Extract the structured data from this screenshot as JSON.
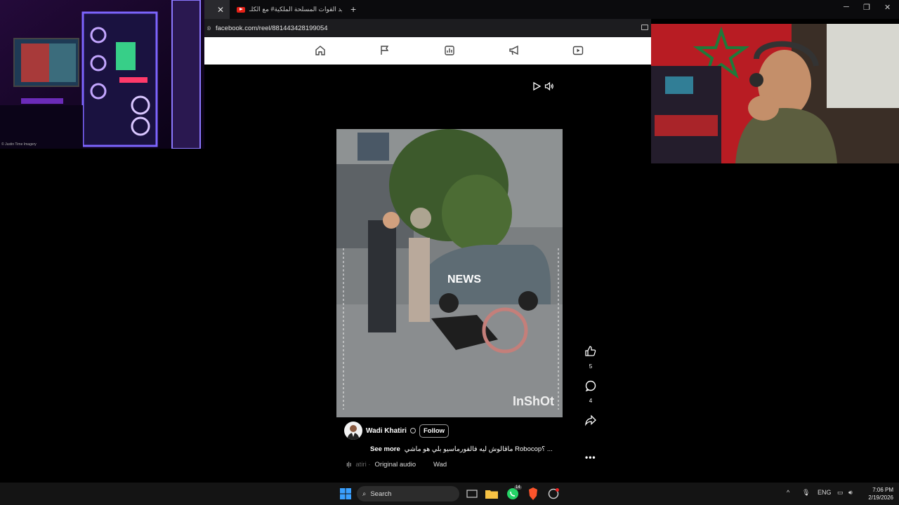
{
  "browser": {
    "tabs": [
      {
        "label": "تفيد القوات المسلحة الملكية# مع الكلـ",
        "icon": "youtube-icon",
        "active": false
      }
    ],
    "url": "facebook.com/reel/881443428199054",
    "new_tab_symbol": "+",
    "close_symbol": "✕"
  },
  "fb_nav": {
    "icons": [
      "home-icon",
      "flag-icon",
      "dashboard-icon",
      "megaphone-icon",
      "video-icon"
    ]
  },
  "desktop_thumbnail": {
    "credit": "© Justin Time Imagery"
  },
  "reel": {
    "video": {
      "watermark": "InShOt",
      "news_tag": "NEWS"
    },
    "actions": {
      "like_count": "5",
      "comment_count": "4"
    },
    "author": {
      "name": "Wadi Khatiri",
      "follow_label": "Follow"
    },
    "caption": {
      "text": "ماقالوش ليه فالفورماسيو بلي هو ماشي Robocop؟ ...",
      "see_more": "See more"
    },
    "audio": {
      "label": "Original audio",
      "faded_prefix": "atiri ·",
      "owner": "Wad"
    },
    "more_label": "•••"
  },
  "taskbar": {
    "search_placeholder": "Search",
    "whatsapp_badge": "14",
    "language": "ENG",
    "time": "7:06 PM",
    "date": "2/19/2026"
  },
  "colors": {
    "facebook_nav_bg": "#ffffff",
    "taskbar_bg": "#141414",
    "youtube_red": "#e62117"
  }
}
